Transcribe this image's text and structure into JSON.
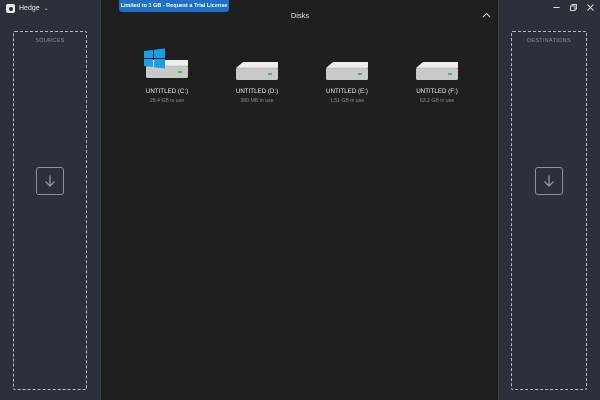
{
  "app": {
    "title": "Hedge"
  },
  "banner": {
    "text": "Limited to 1 GB - Request a Trial License"
  },
  "center": {
    "title": "Disks"
  },
  "sources": {
    "label": "SOURCES"
  },
  "destinations": {
    "label": "DESTINATIONS"
  },
  "disks": [
    {
      "name": "UNTITLED (C:)",
      "usage": "28.4 GB in use",
      "icon": "windows-drive-icon"
    },
    {
      "name": "UNTITLED (D:)",
      "usage": "380 MB in use",
      "icon": "hard-drive-icon"
    },
    {
      "name": "UNTITLED (E:)",
      "usage": "1.51 GB in use",
      "icon": "hard-drive-icon"
    },
    {
      "name": "UNTITLED (F:)",
      "usage": "63.2 GB in use",
      "icon": "hard-drive-icon"
    }
  ],
  "colors": {
    "side_panel": "#2c3038",
    "main_bg": "#1f1f1f",
    "banner": "#1f6fc5",
    "windows_logo": "#1a9fe6",
    "led": "#3ec24a"
  }
}
